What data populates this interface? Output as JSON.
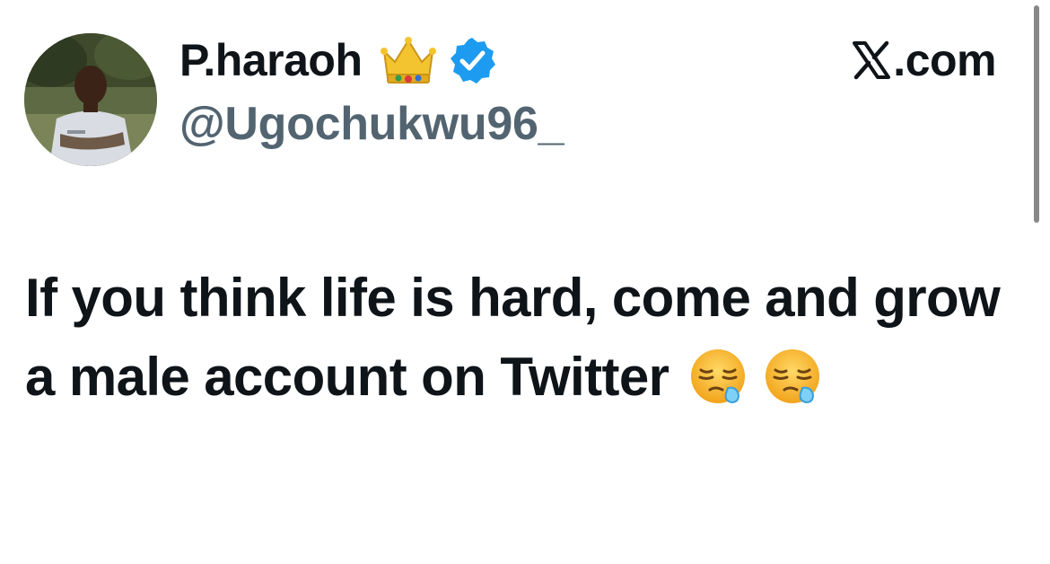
{
  "author": {
    "display_name": "P.haraoh",
    "handle": "@Ugochukwu96_",
    "name_emoji": "crown-icon",
    "verified": true
  },
  "brand": {
    "domain": ".com"
  },
  "tweet": {
    "text": "If you think life is hard, come and grow a male account on Twitter",
    "emojis": [
      "sleepy-face-emoji",
      "sleepy-face-emoji"
    ]
  },
  "colors": {
    "text": "#0f1419",
    "handle": "#536471",
    "verified": "#1d9bf0",
    "scrollbar": "#888888"
  }
}
